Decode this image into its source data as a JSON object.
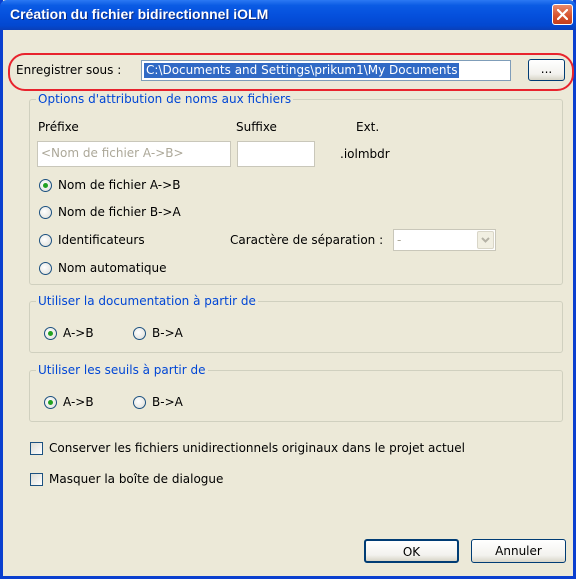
{
  "window": {
    "title": "Création du fichier bidirectionnel iOLM"
  },
  "save_as": {
    "label": "Enregistrer sous :",
    "path": "C:\\Documents and Settings\\prikum1\\My Documents",
    "browse_label": "..."
  },
  "naming": {
    "legend": "Options d'attribution de noms aux fichiers",
    "prefix_label": "Préfixe",
    "suffix_label": "Suffixe",
    "ext_label": "Ext.",
    "prefix_placeholder": "<Nom de fichier A->B>",
    "suffix_value": "",
    "ext_value": ".iolmbdr",
    "options": [
      {
        "label": "Nom de fichier A->B",
        "checked": true
      },
      {
        "label": "Nom de fichier B->A",
        "checked": false
      },
      {
        "label": "Identificateurs",
        "checked": false
      },
      {
        "label": "Nom automatique",
        "checked": false
      }
    ],
    "separator_label": "Caractère de séparation :",
    "separator_value": "-"
  },
  "documentation": {
    "legend": "Utiliser la documentation à partir de",
    "options": [
      {
        "label": "A->B",
        "checked": true
      },
      {
        "label": "B->A",
        "checked": false
      }
    ]
  },
  "thresholds": {
    "legend": "Utiliser les seuils à partir de",
    "options": [
      {
        "label": "A->B",
        "checked": true
      },
      {
        "label": "B->A",
        "checked": false
      }
    ]
  },
  "checkboxes": [
    {
      "label": "Conserver les fichiers unidirectionnels originaux dans le projet actuel",
      "checked": false
    },
    {
      "label": "Masquer la boîte de dialogue",
      "checked": false
    }
  ],
  "buttons": {
    "ok": "OK",
    "cancel": "Annuler"
  },
  "colors": {
    "titlebar": "#0550dd",
    "highlight_ring": "#e8232d",
    "group_legend": "#0046d5",
    "selection": "#316ac5"
  }
}
